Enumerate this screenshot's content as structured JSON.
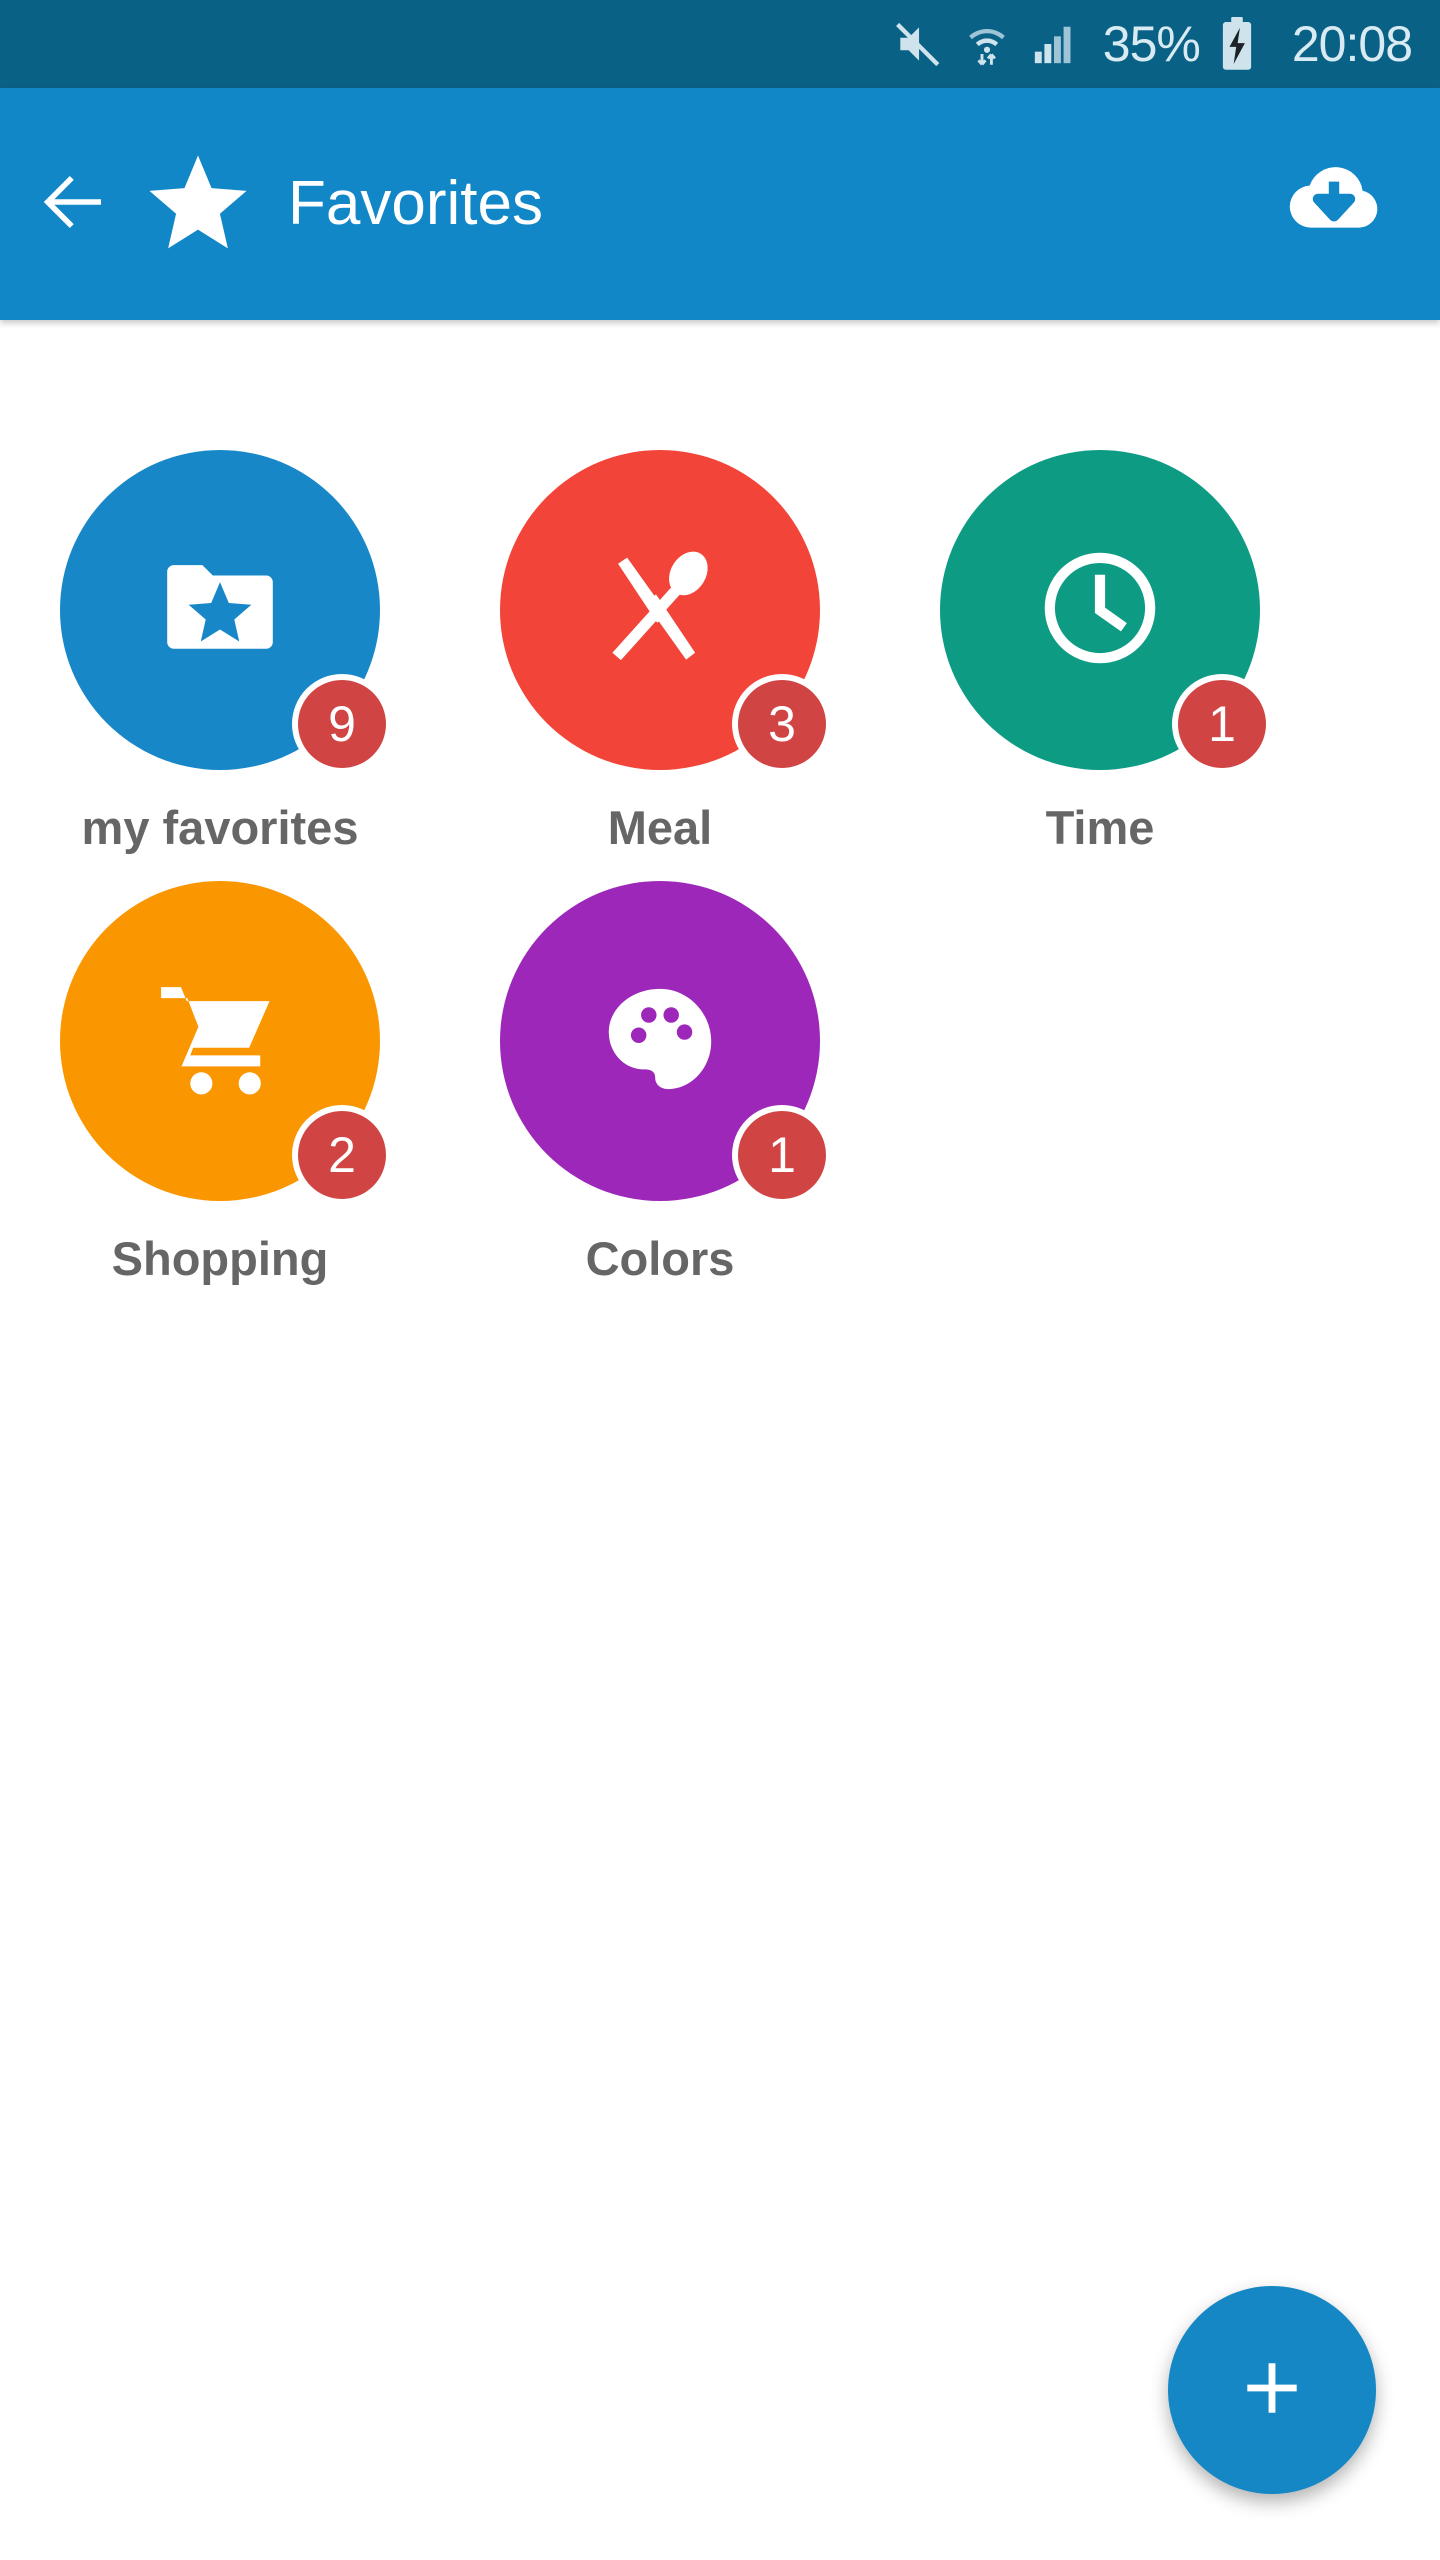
{
  "status_bar": {
    "background": "#0a6186",
    "mute_icon": "mute-icon",
    "wifi_icon": "wifi-transfer-icon",
    "signal_icon": "cellular-signal-icon",
    "battery_percent": "35%",
    "battery_icon": "battery-charging-icon",
    "time": "20:08"
  },
  "app_bar": {
    "background": "#1187c8",
    "back_icon": "back-arrow-icon",
    "star_icon": "star-icon",
    "title": "Favorites",
    "action_icon": "cloud-download-icon"
  },
  "tiles": [
    {
      "label": "my favorites",
      "badge": "9",
      "color": "#1787c8",
      "icon": "folder-star-icon"
    },
    {
      "label": "Meal",
      "badge": "3",
      "color": "#f24438",
      "icon": "fork-spoon-icon"
    },
    {
      "label": "Time",
      "badge": "1",
      "color": "#0d9b84",
      "icon": "clock-icon"
    },
    {
      "label": "Shopping",
      "badge": "2",
      "color": "#fa9600",
      "icon": "shopping-cart-icon"
    },
    {
      "label": "Colors",
      "badge": "1",
      "color": "#9c27b8",
      "icon": "palette-icon"
    }
  ],
  "fab": {
    "icon": "plus-icon",
    "color": "#1687c5"
  },
  "badge_color": "#d04443",
  "label_color": "#666666"
}
